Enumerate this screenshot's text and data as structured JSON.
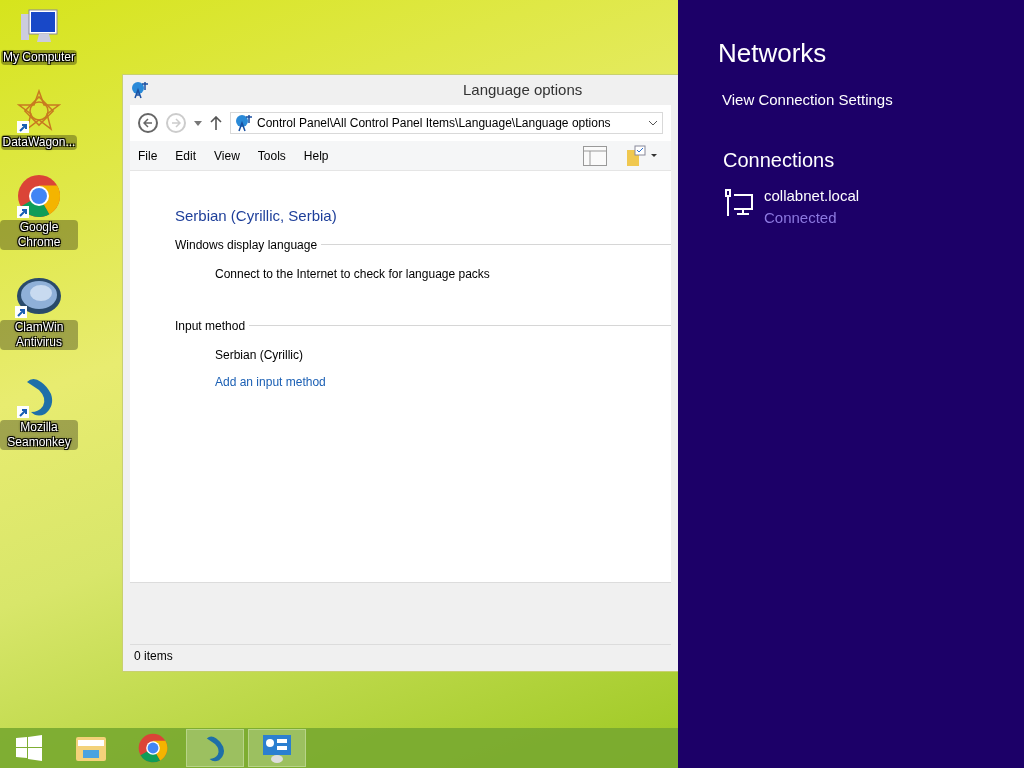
{
  "desktop_icons": [
    {
      "kind": "computer",
      "label": "My Computer",
      "shortcut": false
    },
    {
      "kind": "star",
      "label": "DataWagon...",
      "shortcut": true
    },
    {
      "kind": "chrome",
      "label": "Google Chrome",
      "shortcut": true
    },
    {
      "kind": "clam",
      "label": "ClamWin Antivirus",
      "shortcut": true
    },
    {
      "kind": "lizard",
      "label": "Mozilla Seamonkey",
      "shortcut": true
    }
  ],
  "taskbar": [
    {
      "kind": "start",
      "selected": false
    },
    {
      "kind": "folder",
      "selected": false
    },
    {
      "kind": "chrome",
      "selected": false
    },
    {
      "kind": "lizard",
      "selected": true
    },
    {
      "kind": "panel",
      "selected": true
    }
  ],
  "window": {
    "title": "Language options",
    "back_disabled": false,
    "forward_disabled": true,
    "address": "Control Panel\\All Control Panel Items\\Language\\Language options",
    "menu": [
      "File",
      "Edit",
      "View",
      "Tools",
      "Help"
    ],
    "heading": "Serbian (Cyrillic, Serbia)",
    "sections": [
      {
        "title": "Windows display language",
        "items": [
          {
            "kind": "text",
            "text": "Connect to the Internet to check for language packs"
          }
        ]
      },
      {
        "title": "Input method",
        "items": [
          {
            "kind": "text",
            "text": "Serbian (Cyrillic)"
          },
          {
            "kind": "link",
            "text": "Add an input method"
          }
        ]
      }
    ],
    "status": "0 items"
  },
  "networks": {
    "title": "Networks",
    "settings_link": "View Connection Settings",
    "section": "Connections",
    "connections": [
      {
        "name": "collabnet.local",
        "status": "Connected"
      }
    ]
  }
}
